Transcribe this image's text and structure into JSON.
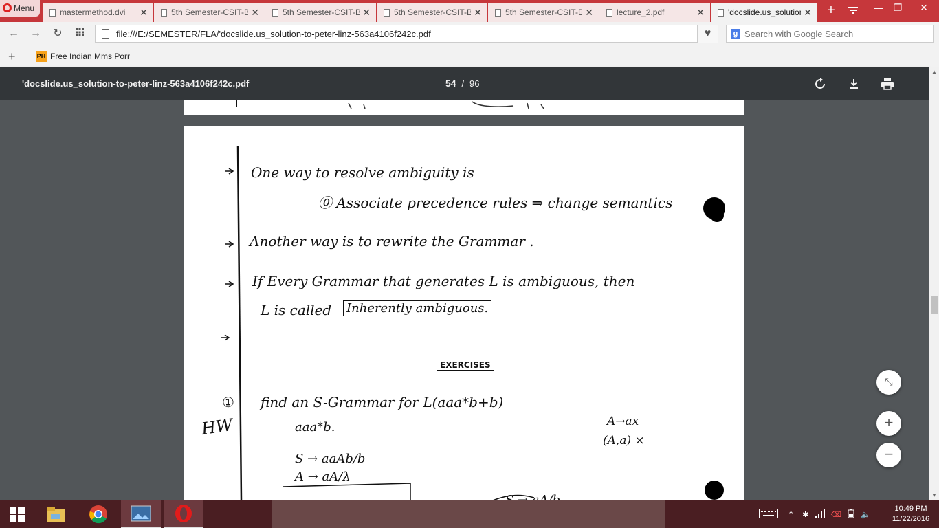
{
  "browser": {
    "menu_label": "Menu",
    "tabs": [
      {
        "label": "mastermethod.dvi"
      },
      {
        "label": "5th Semester-CSIT-B"
      },
      {
        "label": "5th Semester-CSIT-B"
      },
      {
        "label": "5th Semester-CSIT-B"
      },
      {
        "label": "5th Semester-CSIT-B"
      },
      {
        "label": "lecture_2.pdf"
      },
      {
        "label": "'docslide.us_solution"
      }
    ],
    "url": "file:///E:/SEMESTER/FLA/'docslide.us_solution-to-peter-linz-563a4106f242c.pdf",
    "search_placeholder": "Search with Google Search",
    "bookmarks": [
      {
        "icon_text": "PH",
        "label": "Free Indian Mms Porr"
      }
    ]
  },
  "pdf_viewer": {
    "title": "'docslide.us_solution-to-peter-linz-563a4106f242c.pdf",
    "current_page": "54",
    "separator": "/",
    "total_pages": "96"
  },
  "handwriting": {
    "line1": "One way to resolve ambiguity is",
    "line2": "⓪ Associate precedence rules ⇒ change semantics",
    "line3": "Another way is to rewrite the Grammar .",
    "line4a": "If Every Grammar that generates L is ambiguous, then",
    "line4b_pre": "L is called",
    "line4b_box": "Inherently ambiguous.",
    "exercises": "EXERCISES",
    "ex1_num": "①",
    "ex1": "find an S-Grammar for L(aaa*b+b)",
    "hw": "HW",
    "aaab": "aaa*b.",
    "rule1": "S → aaAb/b",
    "rule2": "A → aA/λ",
    "side1": "A→ax",
    "side2": "(A,a)  ×",
    "bottom_partial": "S → aA/b"
  },
  "taskbar": {
    "time": "10:49 PM",
    "date": "11/22/2016"
  }
}
